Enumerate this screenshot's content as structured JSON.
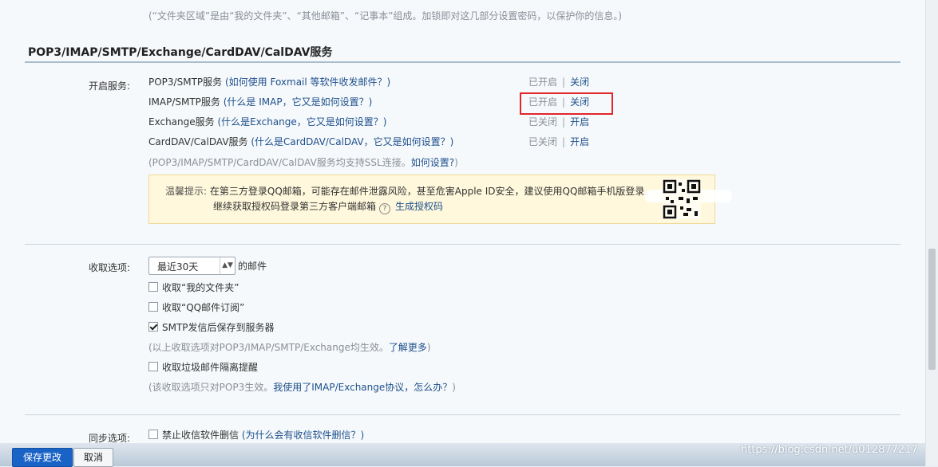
{
  "top_note": "(“文件夹区域”是由“我的文件夹”、“其他邮箱”、“记事本”组成。加锁即对这几部分设置密码，以保护你的信息。)",
  "section_title": "POP3/IMAP/SMTP/Exchange/CardDAV/CalDAV服务",
  "services_label": "开启服务:",
  "services": [
    {
      "name": "POP3/SMTP服务",
      "help_text": "(如何使用 Foxmail 等软件收发邮件？)",
      "status": "已开启",
      "action": "关闭"
    },
    {
      "name": "IMAP/SMTP服务",
      "help_text": "(什么是 IMAP，它又是如何设置？)",
      "status": "已开启",
      "action": "关闭"
    },
    {
      "name": "Exchange服务",
      "help_text": "(什么是Exchange，它又是如何设置？)",
      "status": "已关闭",
      "action": "开启"
    },
    {
      "name": "CardDAV/CalDAV服务",
      "help_text": "(什么是CardDAV/CalDAV，它又是如何设置？)",
      "status": "已关闭",
      "action": "开启"
    }
  ],
  "ssl_note": "(POP3/IMAP/SMTP/CardDAV/CalDAV服务均支持SSL连接。",
  "ssl_link": "如何设置?",
  "ssl_note_end": ")",
  "notice": {
    "title": "温馨提示:",
    "line1": "在第三方登录QQ邮箱，可能存在邮件泄露风险，甚至危害Apple ID安全，建议使用QQ邮箱手机版登录。",
    "line2": "继续获取授权码登录第三方客户端邮箱",
    "help_glyph": "?",
    "link": "生成授权码"
  },
  "receive": {
    "label": "收取选项:",
    "range_value": "最近30天",
    "range_suffix": "的邮件",
    "options": [
      {
        "label": "收取“我的文件夹”",
        "checked": false
      },
      {
        "label": "收取“QQ邮件订阅”",
        "checked": false
      },
      {
        "label": "SMTP发信后保存到服务器",
        "checked": true
      }
    ],
    "note1": "(以上收取选项对POP3/IMAP/SMTP/Exchange均生效。",
    "note1_link": "了解更多",
    "note1_end": ")",
    "spam_option": {
      "label": "收取垃圾邮件隔离提醒",
      "checked": false
    },
    "note2": "(该收取选项只对POP3生效。",
    "note2_link": "我使用了IMAP/Exchange协议，怎么办？",
    "note2_end": ")"
  },
  "sync": {
    "label": "同步选项:",
    "option": {
      "label": "禁止收信软件删信",
      "checked": false
    },
    "help_text": "(为什么会有收信软件删信？)"
  },
  "buttons": {
    "save": "保存更改",
    "cancel": "取消"
  },
  "watermark": "https://blog.csdn.net/u012877217",
  "colors": {
    "accent": "#1a63c6",
    "link": "#1d4f8c",
    "highlight_box": "#e0262a",
    "notice_bg": "#fff8dc"
  }
}
